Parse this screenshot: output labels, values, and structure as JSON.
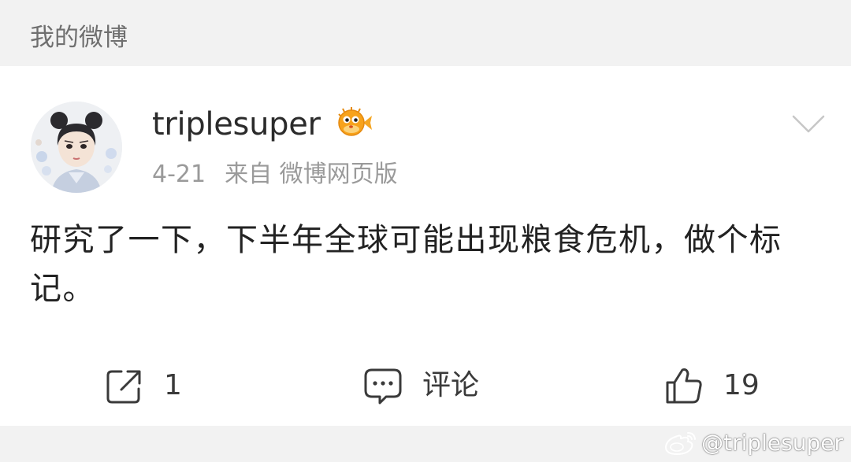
{
  "header": {
    "title": "我的微博"
  },
  "post": {
    "author": {
      "username": "triplesuper",
      "badge_icon": "pufferfish-badge-icon"
    },
    "meta": {
      "date": "4-21",
      "source": "来自 微博网页版"
    },
    "content": "研究了一下，下半年全球可能出现粮食危机，做个标记。",
    "actions": {
      "repost": {
        "icon": "share-icon",
        "count": "1"
      },
      "comment": {
        "icon": "comment-icon",
        "label": "评论"
      },
      "like": {
        "icon": "thumbs-up-icon",
        "count": "19"
      }
    }
  },
  "watermark": {
    "text": "@triplesuper",
    "icon": "weibo-logo-icon"
  },
  "colors": {
    "background": "#f2f2f2",
    "card": "#ffffff",
    "text_primary": "#222222",
    "text_secondary": "#9a9a9a",
    "badge_orange": "#f5a623"
  }
}
